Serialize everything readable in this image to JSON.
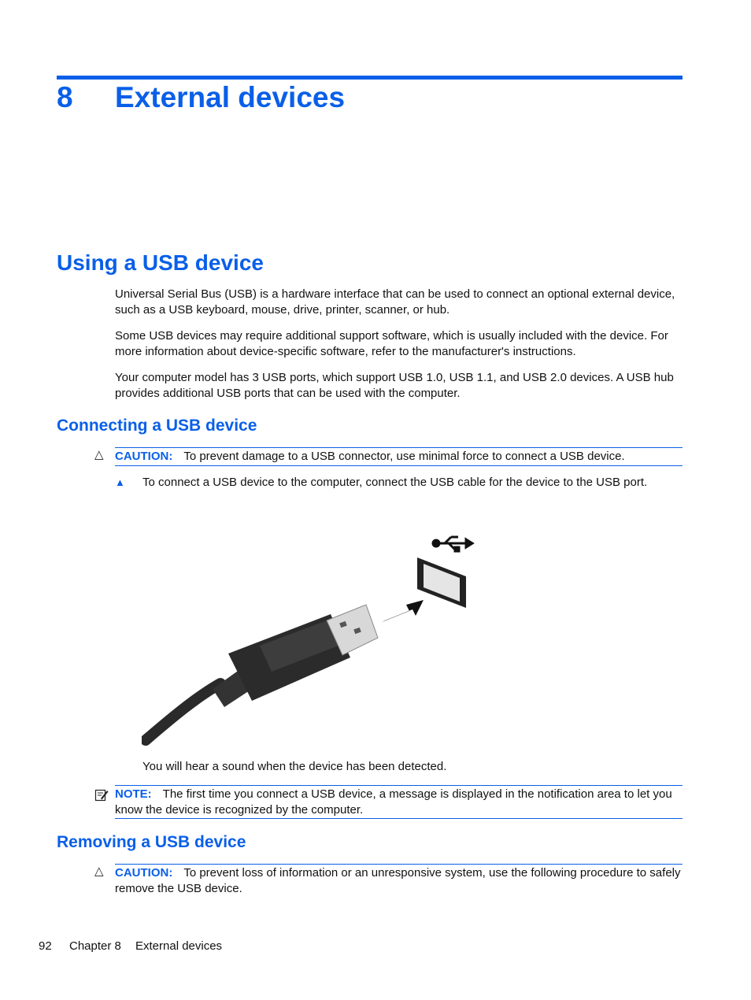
{
  "chapter": {
    "number": "8",
    "title": "External devices"
  },
  "sections": {
    "using": {
      "title": "Using a USB device",
      "paragraphs": [
        "Universal Serial Bus (USB) is a hardware interface that can be used to connect an optional external device, such as a USB keyboard, mouse, drive, printer, scanner, or hub.",
        "Some USB devices may require additional support software, which is usually included with the device. For more information about device-specific software, refer to the manufacturer's instructions.",
        "Your computer model has 3 USB ports, which support USB 1.0, USB 1.1, and USB 2.0 devices. A USB hub provides additional USB ports that can be used with the computer."
      ]
    },
    "connecting": {
      "title": "Connecting a USB device",
      "caution_label": "CAUTION:",
      "caution_text": "To prevent damage to a USB connector, use minimal force to connect a USB device.",
      "step_text": "To connect a USB device to the computer, connect the USB cable for the device to the USB port.",
      "illustration_icon": "usb-plug-into-port-illustration",
      "result_text": "You will hear a sound when the device has been detected.",
      "note_label": "NOTE:",
      "note_text": "The first time you connect a USB device, a message is displayed in the notification area to let you know the device is recognized by the computer."
    },
    "removing": {
      "title": "Removing a USB device",
      "caution_label": "CAUTION:",
      "caution_text": "To prevent loss of information or an unresponsive system, use the following procedure to safely remove the USB device."
    }
  },
  "icons": {
    "caution": "△",
    "step": "▲"
  },
  "footer": {
    "page_number": "92",
    "chapter_label": "Chapter 8",
    "chapter_title": "External devices"
  },
  "colors": {
    "accent": "#0a5fe8",
    "text": "#111111"
  }
}
